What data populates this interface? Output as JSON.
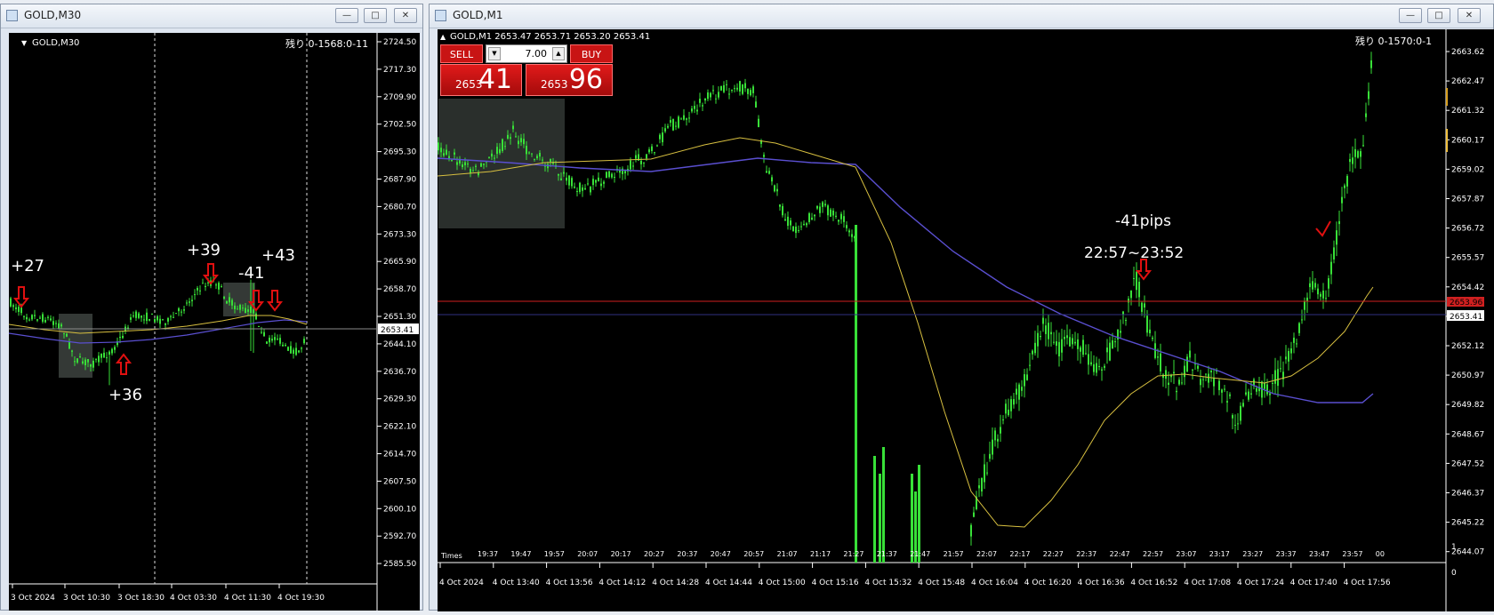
{
  "left_window": {
    "title": "GOLD,M30",
    "chart_label": "GOLD,M30",
    "remaining": "残り 0-1568:0-11",
    "price_axis": [
      "2724.50",
      "2717.30",
      "2709.90",
      "2702.50",
      "2695.30",
      "2687.90",
      "2680.70",
      "2673.30",
      "2665.90",
      "2658.70",
      "2651.30",
      "2644.10",
      "2636.70",
      "2629.30",
      "2622.10",
      "2614.70",
      "2607.50",
      "2600.10",
      "2592.70",
      "2585.50"
    ],
    "current_price": "2653.41",
    "time_axis": [
      "3 Oct 2024",
      "3 Oct 10:30",
      "3 Oct 18:30",
      "4 Oct 03:30",
      "4 Oct 11:30",
      "4 Oct 19:30"
    ],
    "annotations": [
      "+27",
      "+36",
      "+39",
      "-41",
      "+43"
    ]
  },
  "right_window": {
    "title": "GOLD,M1",
    "chart_label": "GOLD,M1  2653.47 2653.71 2653.20 2653.41",
    "remaining": "残り 0-1570:0-1",
    "trade_panel": {
      "sell_label": "SELL",
      "buy_label": "BUY",
      "lot": "7.00",
      "sell_price_small": "2653",
      "sell_price_large": "41",
      "buy_price_small": "2653",
      "buy_price_large": "96"
    },
    "price_axis": [
      "2663.62",
      "2662.47",
      "2661.32",
      "2660.17",
      "2659.02",
      "2657.87",
      "2656.72",
      "2655.57",
      "2654.42",
      "2653.27",
      "2652.12",
      "2650.97",
      "2649.82",
      "2648.67",
      "2647.52",
      "2646.37",
      "2645.22",
      "2644.07"
    ],
    "ask_price": "2653.96",
    "bid_price": "2653.41",
    "indicator_axis": [
      "1",
      "0"
    ],
    "subwindow_label": "Times",
    "minute_axis": [
      "19:37",
      "19:47",
      "19:57",
      "20:07",
      "20:17",
      "20:27",
      "20:37",
      "20:47",
      "20:57",
      "21:07",
      "21:17",
      "21:27",
      "21:37",
      "21:47",
      "21:57",
      "22:07",
      "22:17",
      "22:27",
      "22:37",
      "22:47",
      "22:57",
      "23:07",
      "23:17",
      "23:27",
      "23:37",
      "23:47",
      "23:57",
      "00"
    ],
    "date_axis": [
      "4 Oct 2024",
      "4 Oct 13:40",
      "4 Oct 13:56",
      "4 Oct 14:12",
      "4 Oct 14:28",
      "4 Oct 14:44",
      "4 Oct 15:00",
      "4 Oct 15:16",
      "4 Oct 15:32",
      "4 Oct 15:48",
      "4 Oct 16:04",
      "4 Oct 16:20",
      "4 Oct 16:36",
      "4 Oct 16:52",
      "4 Oct 17:08",
      "4 Oct 17:24",
      "4 Oct 17:40",
      "4 Oct 17:56"
    ],
    "annotation_pips": "-41pips",
    "annotation_time": "22:57~23:52"
  },
  "colors": {
    "candle": "#38e038",
    "ma_fast": "#d8c040",
    "ma_slow": "#5a4fd0",
    "ask_line": "#d02020",
    "bid_line": "#303080",
    "arrow": "#e01010"
  }
}
